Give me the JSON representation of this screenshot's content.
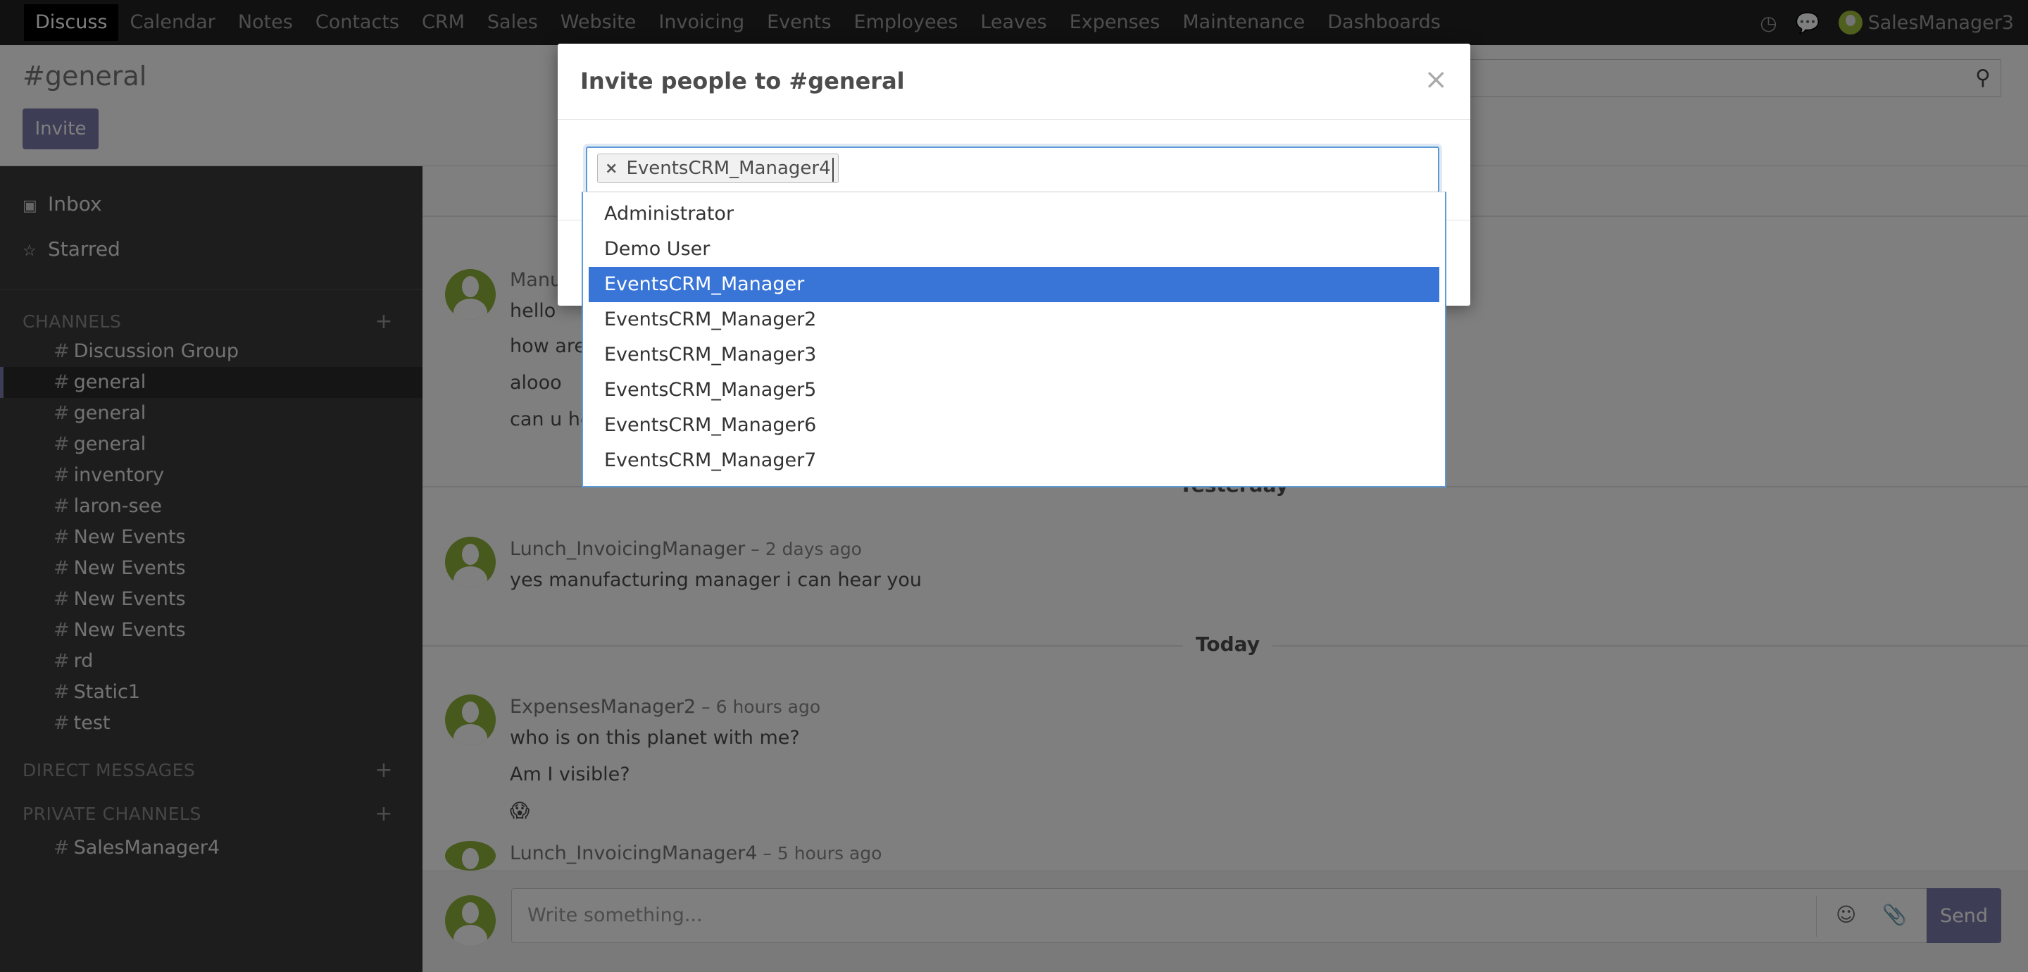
{
  "navbar": {
    "apps": [
      "Discuss",
      "Calendar",
      "Notes",
      "Contacts",
      "CRM",
      "Sales",
      "Website",
      "Invoicing",
      "Events",
      "Employees",
      "Leaves",
      "Expenses",
      "Maintenance",
      "Dashboards"
    ],
    "user": "SalesManager3",
    "icons": [
      "clock-icon",
      "chat-icon"
    ]
  },
  "control_panel": {
    "title": "#general",
    "invite_label": "Invite"
  },
  "sidebar": {
    "inbox": "Inbox",
    "starred": "Starred",
    "channels_header": "CHANNELS",
    "channels": [
      "Discussion Group",
      "general",
      "general",
      "general",
      "inventory",
      "laron-see",
      "New Events",
      "New Events",
      "New Events",
      "New Events",
      "rd",
      "Static1",
      "test"
    ],
    "direct_messages_header": "DIRECT MESSAGES",
    "private_channels_header": "PRIVATE CHANNELS",
    "private_channels": [
      "SalesManager4"
    ]
  },
  "thread": {
    "msg1": {
      "author": "Manu",
      "lines": [
        "hello",
        "how are",
        "alooo",
        "can u he"
      ]
    },
    "day_yesterday": "Yesterday",
    "msg2": {
      "author": "Lunch_InvoicingManager",
      "time": "2 days ago",
      "lines": [
        "yes manufacturing manager i can hear you"
      ]
    },
    "day_today": "Today",
    "msg3": {
      "author": "ExpensesManager2",
      "time": "6 hours ago",
      "lines": [
        "who is on this planet with me?",
        "Am I visible?",
        "😱"
      ]
    },
    "msg4": {
      "author": "Lunch_InvoicingManager4",
      "time": "5 hours ago"
    },
    "composer_placeholder": "Write something...",
    "send_label": "Send"
  },
  "modal": {
    "title": "Invite people to #general",
    "selected_tags": [
      "EventsCRM_Manager4"
    ],
    "options": [
      "Administrator",
      "Demo User",
      "EventsCRM_Manager",
      "EventsCRM_Manager2",
      "EventsCRM_Manager3",
      "EventsCRM_Manager5",
      "EventsCRM_Manager6",
      "EventsCRM_Manager7"
    ],
    "highlighted_option": "EventsCRM_Manager"
  },
  "colors": {
    "accent": "#7c7bad",
    "navbar": "#222222",
    "sidebar": "#3a3a3a",
    "highlight": "#3875d7"
  }
}
